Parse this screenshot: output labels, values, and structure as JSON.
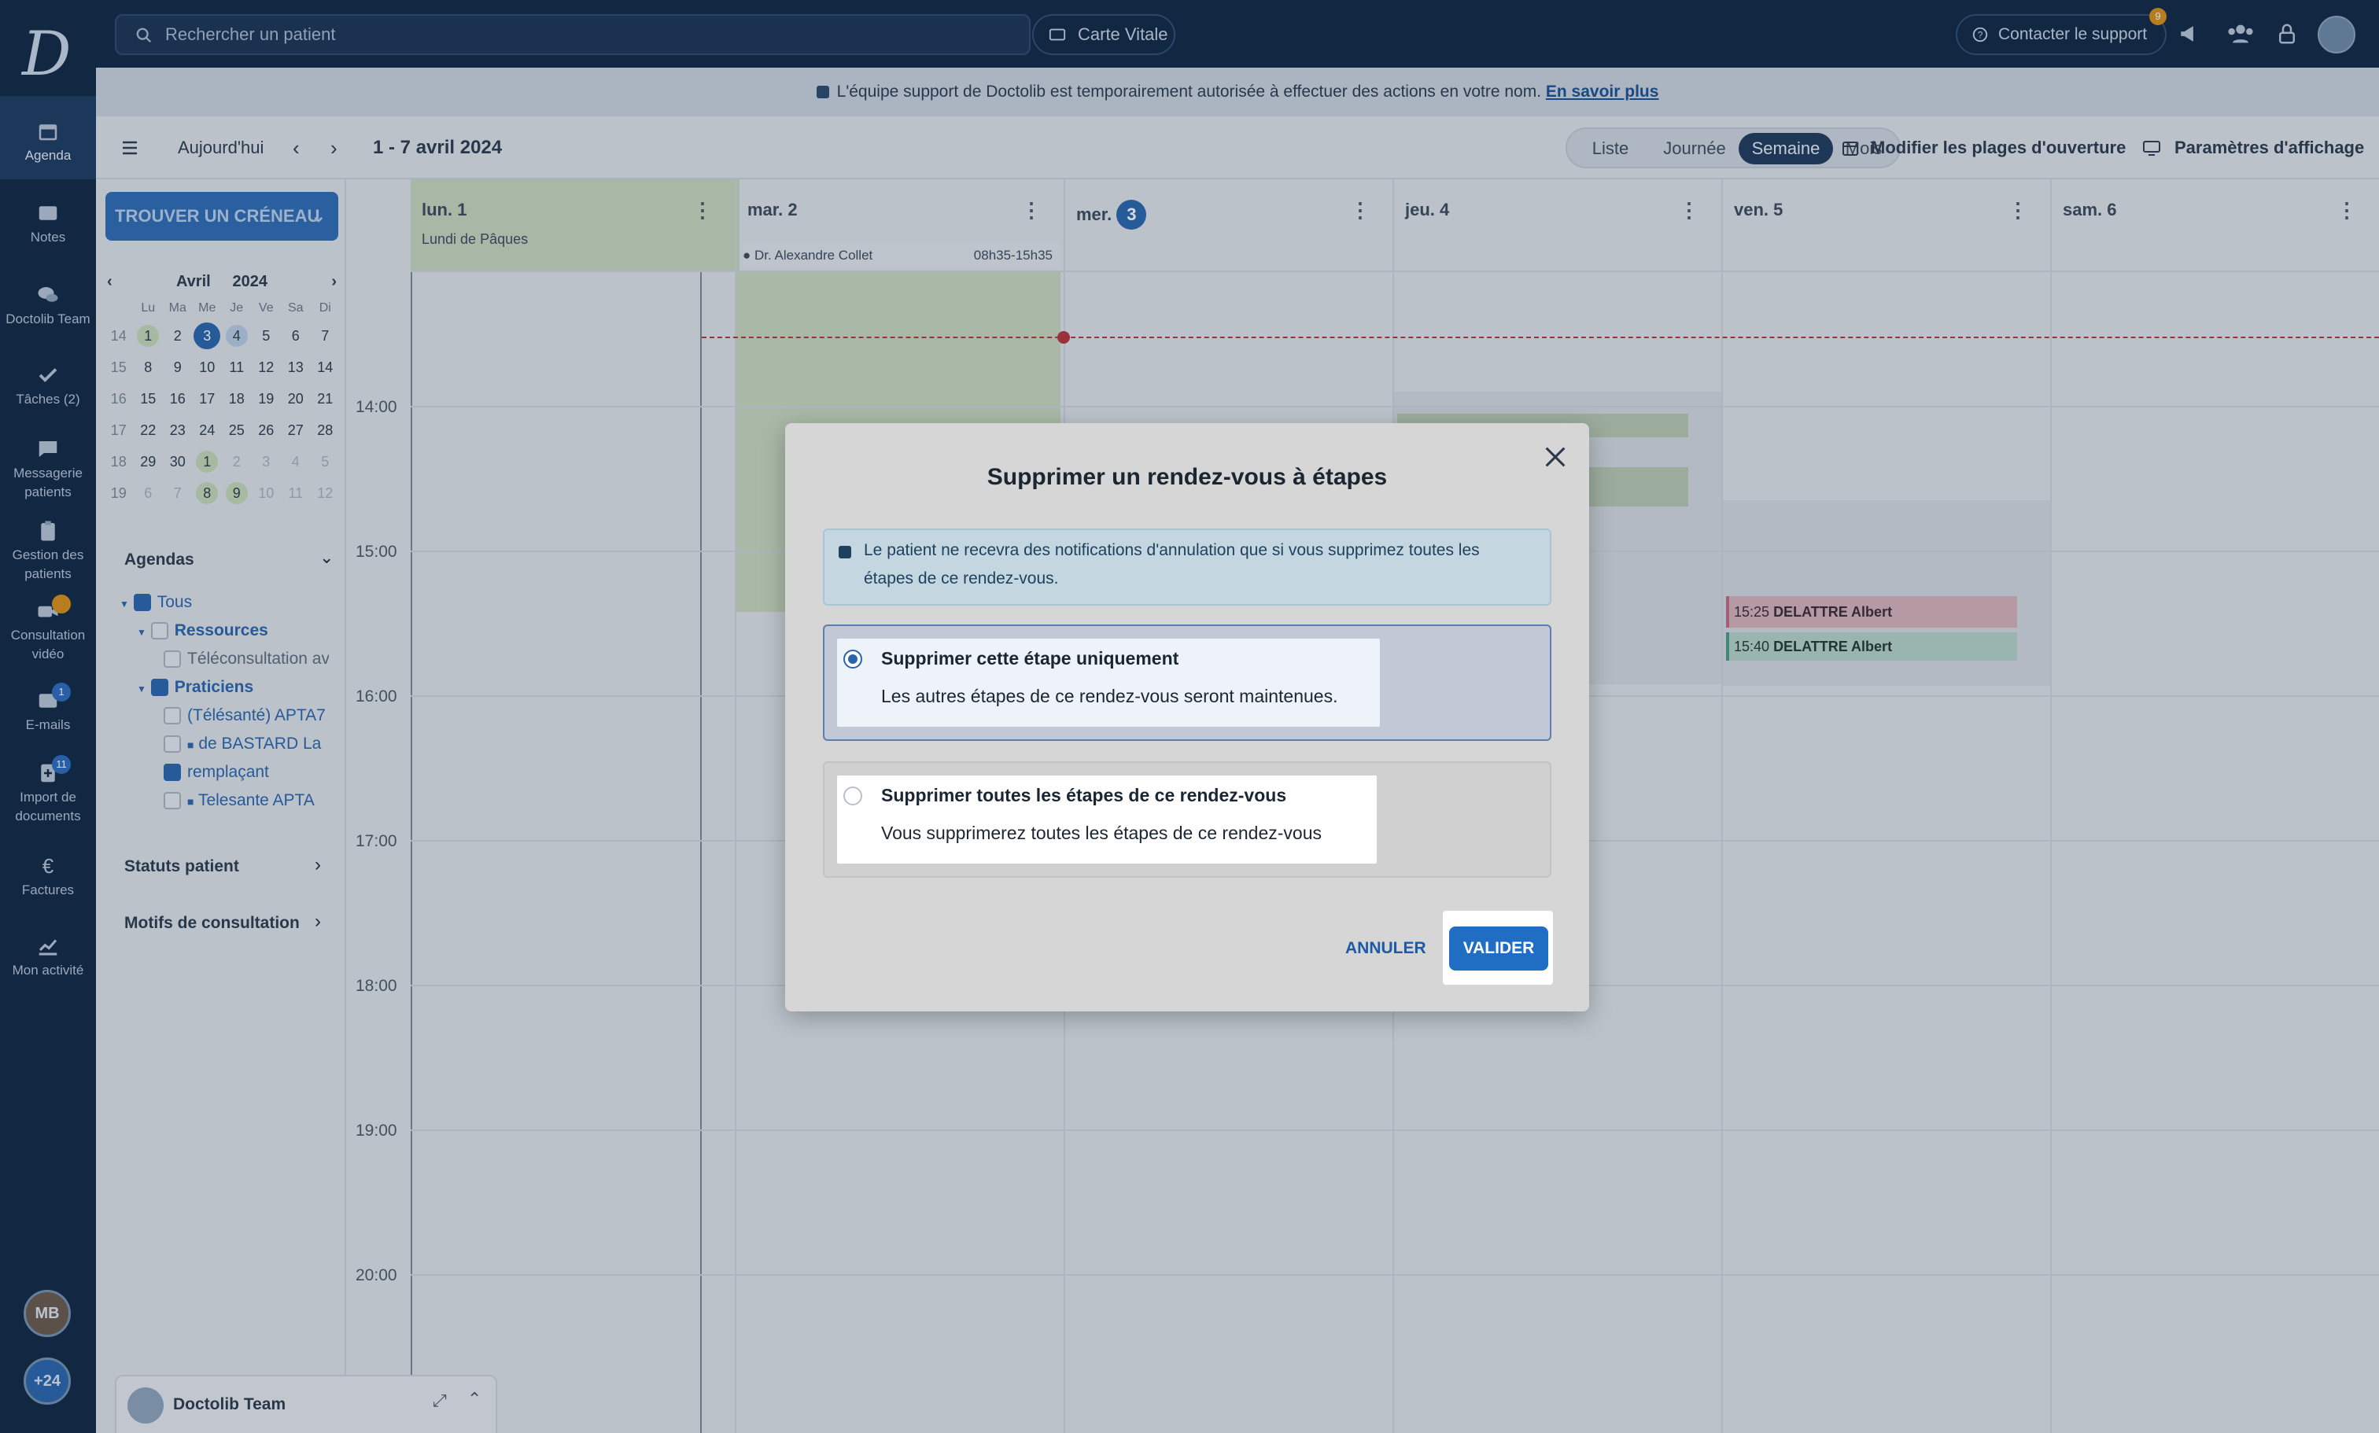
{
  "topbar": {
    "search_placeholder": "Rechercher un patient",
    "carte_vitale": "Carte Vitale",
    "contact_support": "Contacter le support",
    "contact_badge": "9"
  },
  "banner": {
    "text": "L'équipe support de Doctolib est temporairement autorisée à effectuer des actions en votre nom.",
    "link": "En savoir plus"
  },
  "nav": {
    "agenda": "Agenda",
    "notes": "Notes",
    "team": "Doctolib Team",
    "tasks": "Tâches (2)",
    "messaging_1": "Messagerie",
    "messaging_2": "patients",
    "patients_1": "Gestion des",
    "patients_2": "patients",
    "video_1": "Consultation",
    "video_2": "vidéo",
    "emails": "E-mails",
    "emails_badge": "1",
    "import_1": "Import de",
    "import_2": "documents",
    "import_badge": "11",
    "factures": "Factures",
    "activity": "Mon activité",
    "avatar_initials": "MB",
    "more": "+24"
  },
  "toolbar": {
    "today": "Aujourd'hui",
    "range": "1 - 7 avril 2024",
    "views": [
      "Liste",
      "Journée",
      "Semaine",
      "Mois"
    ],
    "selected_view": "Semaine",
    "modify_hours": "Modifier les plages d'ouverture",
    "display_settings": "Paramètres d'affichage"
  },
  "sidebar": {
    "find_slot": "TROUVER UN CRÉNEAU",
    "month": "Avril",
    "year": "2024",
    "day_headers": [
      "Lu",
      "Ma",
      "Me",
      "Je",
      "Ve",
      "Sa",
      "Di"
    ],
    "weeks": [
      {
        "wk": "14",
        "days": [
          "1",
          "2",
          "3",
          "4",
          "5",
          "6",
          "7"
        ]
      },
      {
        "wk": "15",
        "days": [
          "8",
          "9",
          "10",
          "11",
          "12",
          "13",
          "14"
        ]
      },
      {
        "wk": "16",
        "days": [
          "15",
          "16",
          "17",
          "18",
          "19",
          "20",
          "21"
        ]
      },
      {
        "wk": "17",
        "days": [
          "22",
          "23",
          "24",
          "25",
          "26",
          "27",
          "28"
        ]
      },
      {
        "wk": "18",
        "days": [
          "29",
          "30",
          "1",
          "2",
          "3",
          "4",
          "5"
        ]
      },
      {
        "wk": "19",
        "days": [
          "6",
          "7",
          "8",
          "9",
          "10",
          "11",
          "12"
        ]
      }
    ],
    "agendas_title": "Agendas",
    "tree": {
      "all": "Tous",
      "resources": "Ressources",
      "teleconsult": "Téléconsultation av",
      "practitioners": "Praticiens",
      "telesante": "(Télésanté) APTA7",
      "bastard": "de BASTARD La",
      "remplacant": "remplaçant",
      "telesante2": "Telesante APTA"
    },
    "status_title": "Statuts patient",
    "motifs_title": "Motifs de consultation",
    "chat_name": "Doctolib Team"
  },
  "calendar": {
    "days": [
      {
        "label": "lun. 1",
        "sub": "Lundi de Pâques"
      },
      {
        "label": "mar. 2",
        "sub": ""
      },
      {
        "label": "mer.",
        "num": "3"
      },
      {
        "label": "jeu. 4"
      },
      {
        "label": "ven. 5"
      },
      {
        "label": "sam. 6"
      }
    ],
    "doctor": "Dr. Alexandre Collet",
    "doctor_hours": "08h35-15h35",
    "times": [
      "14:00",
      "15:00",
      "16:00",
      "17:00",
      "18:00",
      "19:00",
      "20:00"
    ],
    "appt1_time": "15:25",
    "appt1_name": "DELATTRE Albert",
    "appt2_time": "15:40",
    "appt2_name": "DELATTRE Albert"
  },
  "modal": {
    "title": "Supprimer un rendez-vous à étapes",
    "info_line1": "Le patient ne recevra des notifications d'annulation que si vous supprimez toutes les",
    "info_line2": "étapes de ce rendez-vous.",
    "option1_title": "Supprimer cette étape uniquement",
    "option1_desc": "Les autres étapes de ce rendez-vous seront maintenues.",
    "option2_title": "Supprimer toutes les étapes de ce rendez-vous",
    "option2_desc": "Vous supprimerez toutes les étapes de ce rendez-vous",
    "cancel": "ANNULER",
    "confirm": "VALIDER",
    "selected_option": 1
  }
}
